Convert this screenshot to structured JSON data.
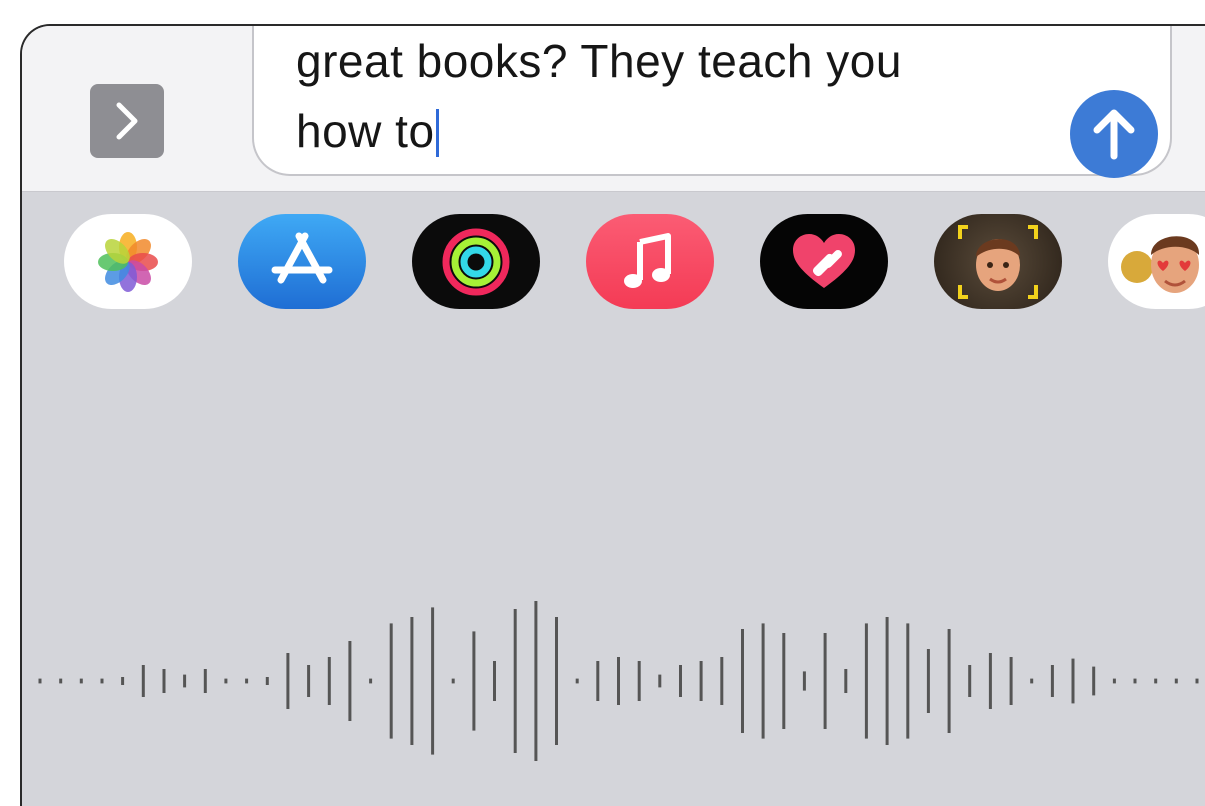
{
  "composer": {
    "line1": "great books? They teach you",
    "line2": "how to"
  },
  "buttons": {
    "expand_icon": "chevron-right-icon",
    "send_icon": "arrow-up-icon"
  },
  "app_drawer": {
    "apps": [
      {
        "name": "photos",
        "icon": "photos-icon"
      },
      {
        "name": "app-store",
        "icon": "app-store-icon"
      },
      {
        "name": "activity",
        "icon": "activity-rings-icon"
      },
      {
        "name": "music",
        "icon": "music-note-icon"
      },
      {
        "name": "digital-touch",
        "icon": "heart-touch-icon"
      },
      {
        "name": "memoji",
        "icon": "memoji-icon"
      },
      {
        "name": "memoji-stickers",
        "icon": "memoji-stickers-icon"
      }
    ]
  },
  "dictation": {
    "waveform_levels": [
      0.03,
      0.03,
      0.03,
      0.03,
      0.05,
      0.2,
      0.15,
      0.08,
      0.15,
      0.03,
      0.03,
      0.05,
      0.35,
      0.2,
      0.3,
      0.5,
      0.03,
      0.72,
      0.8,
      0.92,
      0.03,
      0.62,
      0.25,
      0.9,
      1.0,
      0.8,
      0.03,
      0.25,
      0.3,
      0.25,
      0.08,
      0.2,
      0.25,
      0.3,
      0.65,
      0.72,
      0.6,
      0.12,
      0.6,
      0.15,
      0.72,
      0.8,
      0.72,
      0.4,
      0.65,
      0.2,
      0.35,
      0.3,
      0.03,
      0.2,
      0.28,
      0.18,
      0.03,
      0.03,
      0.03,
      0.03,
      0.03
    ],
    "colors": {
      "bar": "#555555"
    }
  },
  "colors": {
    "send": "#3d7bd6",
    "caret": "#2f6ad8",
    "drawer_bg": "#d4d5da"
  }
}
